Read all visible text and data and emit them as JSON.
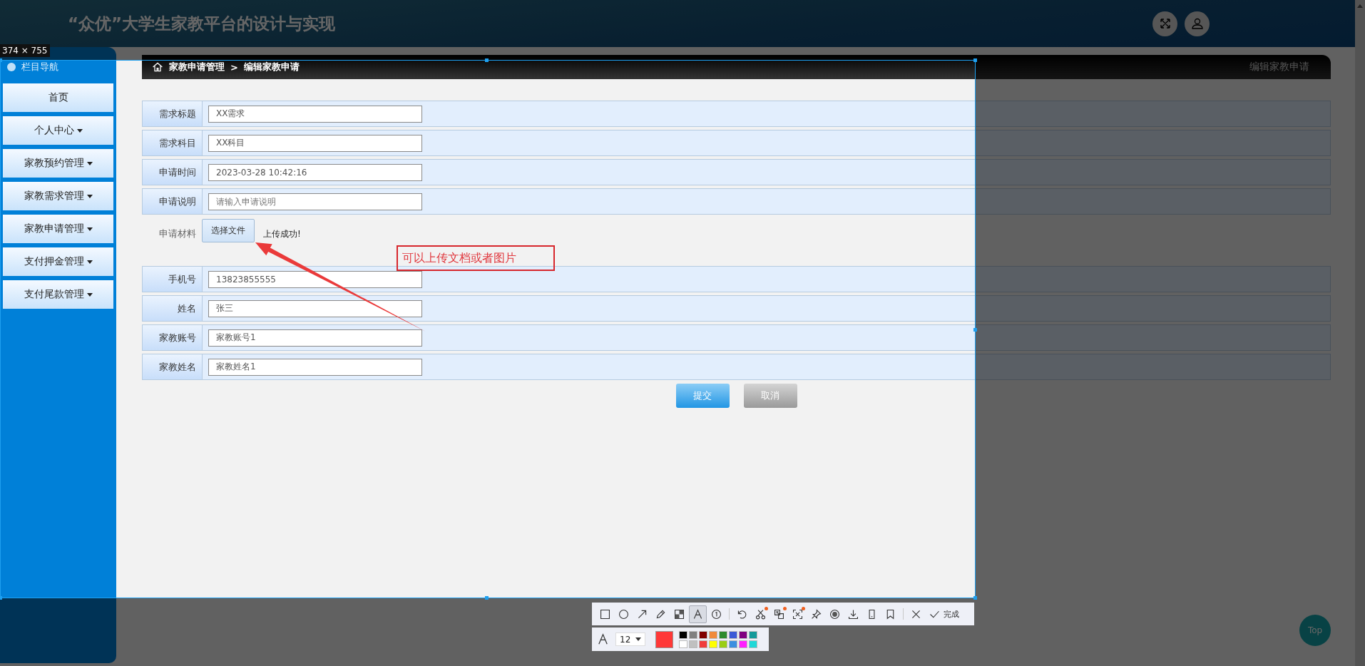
{
  "header": {
    "title": "“众优”大学生家教平台的设计与实现",
    "actions": [
      {
        "kind": "fullscreen"
      },
      {
        "kind": "user"
      }
    ]
  },
  "sidebar": {
    "title": "栏目导航",
    "items": [
      {
        "label": "首页",
        "expandable": false
      },
      {
        "label": "个人中心",
        "expandable": true
      },
      {
        "label": "家教预约管理",
        "expandable": true
      },
      {
        "label": "家教需求管理",
        "expandable": true
      },
      {
        "label": "家教申请管理",
        "expandable": true
      },
      {
        "label": "支付押金管理",
        "expandable": true
      },
      {
        "label": "支付尾款管理",
        "expandable": true
      }
    ]
  },
  "breadcrumb": {
    "items": [
      "家教申请管理",
      "编辑家教申请"
    ],
    "separator": ">",
    "page_title": "编辑家教申请"
  },
  "form": {
    "fields": [
      {
        "kind": "text",
        "label": "需求标题",
        "value": "XX需求"
      },
      {
        "kind": "text",
        "label": "需求科目",
        "value": "XX科目"
      },
      {
        "kind": "text",
        "label": "申请时间",
        "value": "2023-03-28 10:42:16"
      },
      {
        "kind": "text",
        "label": "申请说明",
        "placeholder": "请输入申请说明"
      },
      {
        "kind": "upload",
        "label": "申请材料",
        "button": "选择文件",
        "status": "上传成功!"
      },
      {
        "kind": "text",
        "label": "手机号",
        "value": "13823855555"
      },
      {
        "kind": "text",
        "label": "姓名",
        "value": "张三"
      },
      {
        "kind": "text",
        "label": "家教账号",
        "value": "家教账号1"
      },
      {
        "kind": "text",
        "label": "家教姓名",
        "value": "家教姓名1"
      }
    ],
    "buttons": [
      {
        "kind": "primary",
        "label": "提交"
      },
      {
        "kind": "secondary",
        "label": "取消"
      }
    ]
  },
  "back_to_top": "Top",
  "capture": {
    "size_label": "374 × 755",
    "annotation": "可以上传文档或者图片",
    "tool_groups": [
      [
        {
          "kind": "rectangle",
          "selected": false
        },
        {
          "kind": "ellipse",
          "selected": false
        },
        {
          "kind": "arrow",
          "selected": false
        },
        {
          "kind": "pencil",
          "selected": false
        },
        {
          "kind": "mosaic",
          "selected": false
        },
        {
          "kind": "text",
          "selected": true
        },
        {
          "kind": "number",
          "selected": false
        }
      ],
      [
        {
          "kind": "undo",
          "selected": false
        },
        {
          "kind": "scissors",
          "selected": false,
          "badge": true
        },
        {
          "kind": "translate",
          "selected": false,
          "badge": true
        },
        {
          "kind": "ocr",
          "selected": false,
          "badge": true
        },
        {
          "kind": "pin",
          "selected": false
        },
        {
          "kind": "record",
          "selected": false
        },
        {
          "kind": "download",
          "selected": false
        },
        {
          "kind": "phone",
          "selected": false
        },
        {
          "kind": "bookmark",
          "selected": false
        }
      ],
      [
        {
          "kind": "close",
          "selected": false
        }
      ]
    ],
    "done_label": "完成",
    "font_size": "12",
    "current_swatch": {
      "color": "#ff3838"
    },
    "palette": [
      {
        "color": "#000000",
        "selected": false
      },
      {
        "color": "#808080",
        "selected": false
      },
      {
        "color": "#800000",
        "selected": false
      },
      {
        "color": "#f08a3a",
        "selected": false
      },
      {
        "color": "#2e8b2e",
        "selected": false
      },
      {
        "color": "#3c5bd6",
        "selected": false
      },
      {
        "color": "#800080",
        "selected": false
      },
      {
        "color": "#149a9a",
        "selected": false
      },
      {
        "color": "#ffffff",
        "selected": false
      },
      {
        "color": "#c0c0c0",
        "selected": false
      },
      {
        "color": "#f03c3c",
        "selected": false
      },
      {
        "color": "#ffff00",
        "selected": false
      },
      {
        "color": "#9acd14",
        "selected": false
      },
      {
        "color": "#3a8fe0",
        "selected": false
      },
      {
        "color": "#ff20ff",
        "selected": false
      },
      {
        "color": "#20d8d8",
        "selected": false
      }
    ]
  }
}
